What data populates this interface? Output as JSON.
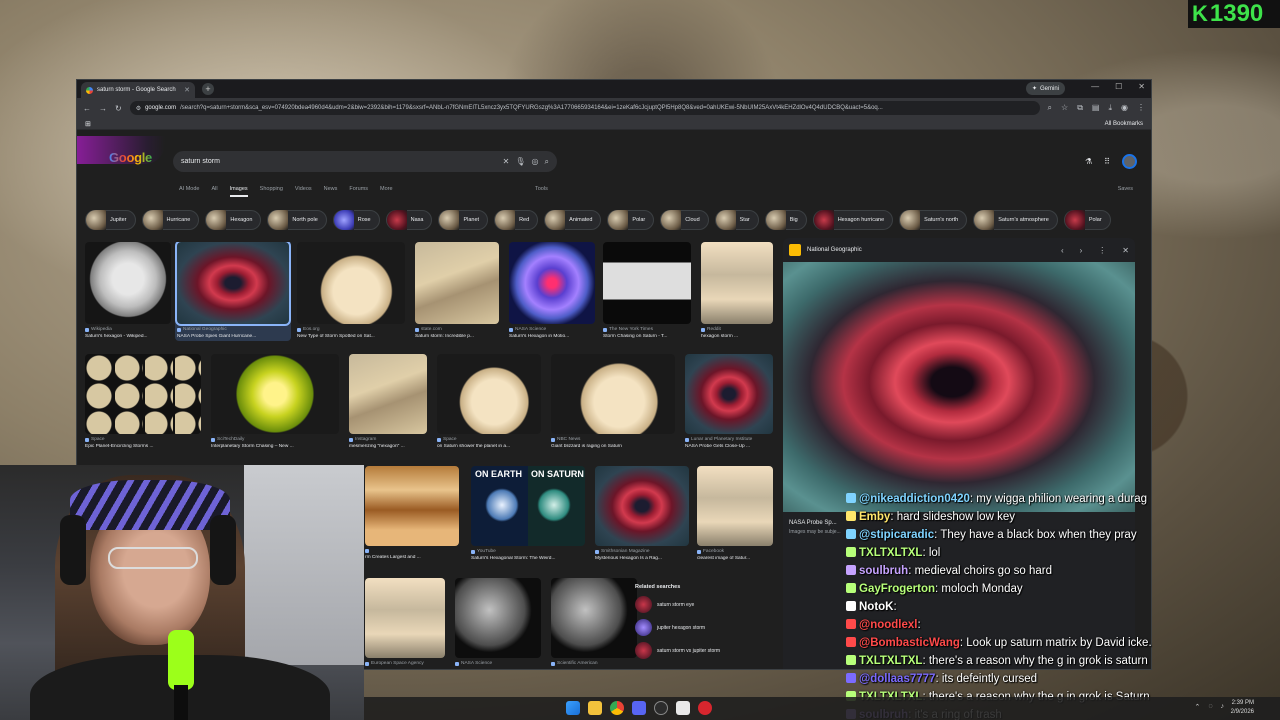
{
  "counter": {
    "symbol": "K",
    "value": "1390"
  },
  "browser": {
    "tab_title": "saturn storm - Google Search",
    "gemini_label": "Gemini",
    "url_host": "google.com",
    "url_path": "/search?q=saturn+storm&sca_esv=074920bdea4960d4&udm=2&biw=2392&bih=1179&sxsrf=ANbL-n7fGNmEITL5xncz3yx5TQFYURGszg%3A1770665934164&ei=1zeKaf6cJcjuptQPl5Hp8Q8&ved=0ahUKEwi-5NbUIM25AxVt4kEHZdlOv4Q4dUDCBQ&uact=5&oq...",
    "bookmarks_label": "All Bookmarks"
  },
  "search": {
    "logo": "Google",
    "query": "saturn storm",
    "nav_tabs": [
      "AI Mode",
      "All",
      "Images",
      "Shopping",
      "Videos",
      "News",
      "Forums",
      "More"
    ],
    "tools": "Tools",
    "saves": "Saves"
  },
  "chips": [
    "Jupiter",
    "Hurricane",
    "Hexagon",
    "North pole",
    "Rose",
    "Nasa",
    "Planet",
    "Red",
    "Animated",
    "Polar",
    "Cloud",
    "Star",
    "Big",
    "Hexagon hurricane",
    "Saturn's north",
    "Saturn's atmosphere",
    "Polar"
  ],
  "results": [
    {
      "source": "Wikipedia",
      "title": "Saturn's hexagon - Wikiped..."
    },
    {
      "source": "National Geographic",
      "title": "NASA Probe Spies Giant Hurricane..."
    },
    {
      "source": "Eos.org",
      "title": "New Type of Storm Spotted on Sat..."
    },
    {
      "source": "state.com",
      "title": "Saturn storm: Incredible p..."
    },
    {
      "source": "NASA Science",
      "title": "Saturn's Hexagon in Motio..."
    },
    {
      "source": "The New York Times",
      "title": "Storm Chasing on Saturn - T..."
    },
    {
      "source": "Reddit",
      "title": "hexagon storm ..."
    },
    {
      "source": "Space",
      "title": "Epic Planet-Encircling Storms ..."
    },
    {
      "source": "SciTechDaily",
      "title": "Interplanetary Storm Chasing – New ..."
    },
    {
      "source": "Instagram",
      "title": "mesmerizing \"hexagon\" ..."
    },
    {
      "source": "Space",
      "title": "on Saturn shower the planet in a..."
    },
    {
      "source": "NBC News",
      "title": "Giant blizzard is raging on Saturn"
    },
    {
      "source": "Lunar and Planetary Institute",
      "title": "NASA Probe Gets Close-Up ..."
    },
    {
      "source": "",
      "title": "rm Creates Largest and ..."
    },
    {
      "source": "YouTube",
      "title": "Saturn's Hexagonal Storm: The Weird..."
    },
    {
      "source": "Smithsonian Magazine",
      "title": "Mysterious Hexagon Is a Rag..."
    },
    {
      "source": "Facebook",
      "title": "clearest image of Satur..."
    },
    {
      "source": "European Space Agency",
      "title": ""
    },
    {
      "source": "NASA Science",
      "title": ""
    },
    {
      "source": "Scientific American",
      "title": ""
    }
  ],
  "earth_saturn": {
    "left": "ON EARTH",
    "right": "ON SATURN"
  },
  "related": {
    "heading": "Related searches",
    "items": [
      "saturn storm eye",
      "jupiter hexagon storm",
      "saturn storm vs jupiter storm"
    ]
  },
  "preview": {
    "source": "National Geographic",
    "title": "NASA Probe Sp...",
    "subtitle": "Images may be subje..."
  },
  "chat": [
    {
      "user": "@nikeaddiction0420",
      "text": ": my wigga philion wearing a durag",
      "color": "#7fd3ff"
    },
    {
      "user": "Emby",
      "text": ": hard slideshow low key",
      "color": "#ffe66b"
    },
    {
      "user": "@stipicaradic",
      "text": ": They have a black box when they pray",
      "color": "#7fd3ff"
    },
    {
      "user": "TXLTXLTXL",
      "text": ": lol",
      "color": "#b7ff7a"
    },
    {
      "user": "soulbruh",
      "text": ": medieval choirs go so hard",
      "color": "#c6a3ff"
    },
    {
      "user": "GayFrogerton",
      "text": ": moloch Monday",
      "color": "#b7ff7a"
    },
    {
      "user": "NotoK",
      "text": ": ",
      "color": "#ffffff"
    },
    {
      "user": "@noodlexl",
      "text": ":",
      "color": "#ff4a4a"
    },
    {
      "user": "@BombasticWang",
      "text": ": Look up saturn matrix by David icke.",
      "color": "#ff4a4a"
    },
    {
      "user": "TXLTXLTXL",
      "text": ": there's a reason why the g in grok is saturn",
      "color": "#b7ff7a"
    },
    {
      "user": "@dollaas7777",
      "text": ": its defeintly cursed",
      "color": "#7b6bff"
    },
    {
      "user": "TXLTXLTXL",
      "text": ": there's a reason why the g in grok is Saturn",
      "color": "#b7ff7a"
    },
    {
      "user": "soulbruh",
      "text": ": it's a ring of trash",
      "color": "#c6a3ff"
    }
  ],
  "taskbar": {
    "time": "2:39 PM",
    "date": "2/9/2026"
  }
}
